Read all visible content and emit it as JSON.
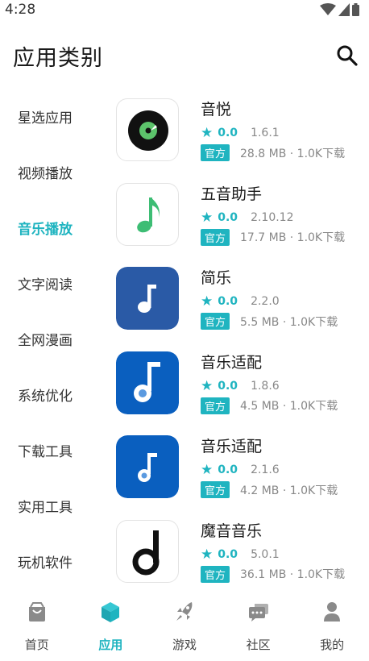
{
  "status_bar": {
    "time": "4:28"
  },
  "header": {
    "title": "应用类别",
    "search_icon": "search-icon"
  },
  "sidebar": {
    "items": [
      {
        "label": "星选应用"
      },
      {
        "label": "视频播放"
      },
      {
        "label": "音乐播放",
        "active": true
      },
      {
        "label": "文字阅读"
      },
      {
        "label": "全网漫画"
      },
      {
        "label": "系统优化"
      },
      {
        "label": "下载工具"
      },
      {
        "label": "实用工具"
      },
      {
        "label": "玩机软件"
      }
    ]
  },
  "apps": [
    {
      "name": "音悦",
      "rating": "0.0",
      "version": "1.6.1",
      "badge": "官方",
      "meta": "28.8 MB · 1.0K下载",
      "icon": "vinyl-record-icon"
    },
    {
      "name": "五音助手",
      "rating": "0.0",
      "version": "2.10.12",
      "badge": "官方",
      "meta": "17.7 MB · 1.0K下载",
      "icon": "green-note-icon"
    },
    {
      "name": "简乐",
      "rating": "0.0",
      "version": "2.2.0",
      "badge": "官方",
      "meta": "5.5 MB · 1.0K下载",
      "icon": "white-note-blue-icon"
    },
    {
      "name": "音乐适配",
      "rating": "0.0",
      "version": "1.8.6",
      "badge": "官方",
      "meta": "4.5 MB · 1.0K下载",
      "icon": "music-adapt-icon"
    },
    {
      "name": "音乐适配",
      "rating": "0.0",
      "version": "2.1.6",
      "badge": "官方",
      "meta": "4.2 MB · 1.0K下载",
      "icon": "music-adapt-icon"
    },
    {
      "name": "魔音音乐",
      "rating": "0.0",
      "version": "5.0.1",
      "badge": "官方",
      "meta": "36.1 MB · 1.0K下载",
      "icon": "black-d-note-icon"
    }
  ],
  "tabbar": {
    "items": [
      {
        "label": "首页",
        "icon": "home-bag-icon"
      },
      {
        "label": "应用",
        "icon": "app-cube-icon",
        "active": true
      },
      {
        "label": "游戏",
        "icon": "rocket-icon"
      },
      {
        "label": "社区",
        "icon": "chat-bubbles-icon"
      },
      {
        "label": "我的",
        "icon": "person-icon"
      }
    ]
  },
  "colors": {
    "accent": "#1fb4c0",
    "text": "#222222",
    "muted": "#888888",
    "icon_gray": "#8a8a8a"
  }
}
